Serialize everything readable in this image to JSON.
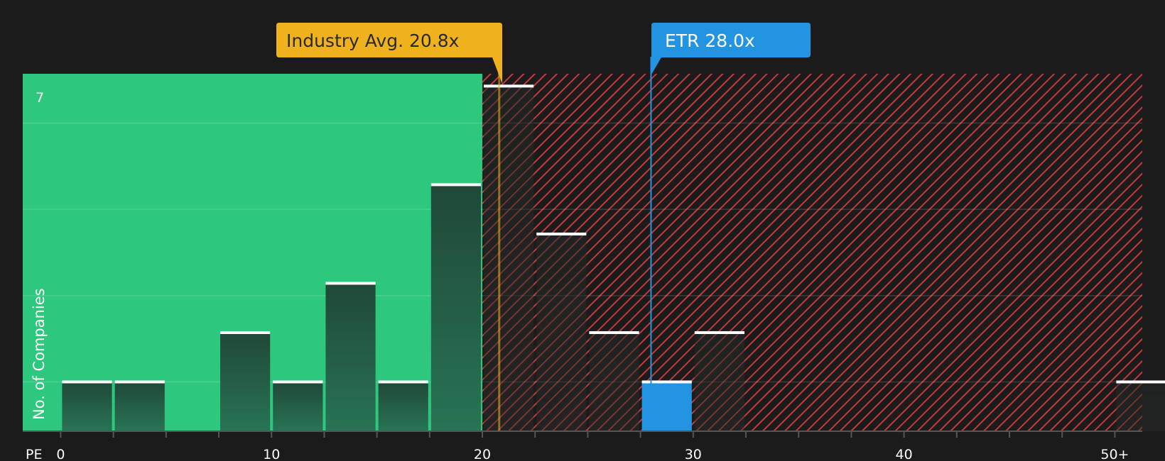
{
  "chart_data": {
    "type": "bar",
    "bins": [
      {
        "from": 0,
        "to": 2.5,
        "count": 1
      },
      {
        "from": 2.5,
        "to": 5,
        "count": 1
      },
      {
        "from": 5,
        "to": 7.5,
        "count": 0
      },
      {
        "from": 7.5,
        "to": 10,
        "count": 2
      },
      {
        "from": 10,
        "to": 12.5,
        "count": 1
      },
      {
        "from": 12.5,
        "to": 15,
        "count": 3
      },
      {
        "from": 15,
        "to": 17.5,
        "count": 1
      },
      {
        "from": 17.5,
        "to": 20,
        "count": 5
      },
      {
        "from": 20,
        "to": 22.5,
        "count": 7
      },
      {
        "from": 22.5,
        "to": 25,
        "count": 4
      },
      {
        "from": 25,
        "to": 27.5,
        "count": 2
      },
      {
        "from": 27.5,
        "to": 30,
        "count": 1
      },
      {
        "from": 30,
        "to": 32.5,
        "count": 2
      },
      {
        "from": 50,
        "to": 52.5,
        "count": 1
      }
    ],
    "x_ticks": [
      {
        "value": 0,
        "label": "0"
      },
      {
        "value": 10,
        "label": "10"
      },
      {
        "value": 20,
        "label": "20"
      },
      {
        "value": 30,
        "label": "30"
      },
      {
        "value": 40,
        "label": "40"
      },
      {
        "value": 50,
        "label": "50+"
      }
    ],
    "x_axis_label": "PE",
    "y_axis_label": "No. of Companies",
    "y_max_label": "7",
    "xlim": [
      -1.8,
      51.3
    ],
    "ylim": [
      0,
      7.25
    ],
    "good_zone_until": 20,
    "industry_avg": {
      "value": 20.8,
      "label": "Industry Avg. 20.8x"
    },
    "company": {
      "value": 28.0,
      "label": "ETR 28.0x",
      "bin_index": 11
    },
    "grid": true,
    "colors": {
      "background": "#1b1b1b",
      "good_zone": "#2ec77e",
      "bad_zone_hatch": "#c23a3a",
      "bar_dark": "#204838",
      "bar_dark_bottom": "#287454",
      "company_bar": "#2394e1",
      "industry": "#efb21e",
      "bar_cap": "#ffffff"
    }
  }
}
